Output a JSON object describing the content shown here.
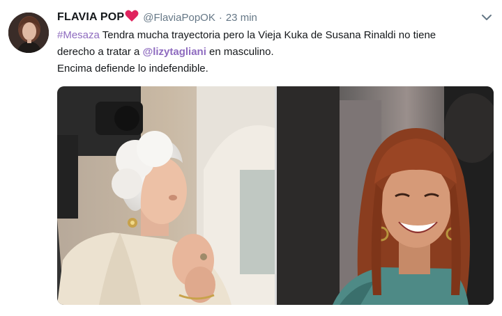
{
  "tweet": {
    "author_name": "FLAVIA POP",
    "handle": "@FlaviaPopOK",
    "separator": "·",
    "time": "23 min",
    "text": {
      "hashtag": "#Mesaza",
      "line1_rest": " Tendra mucha trayectoria pero la Vieja Kuka de Susana Rinaldi no tiene",
      "line2_start": "derecho a tratar a ",
      "mention": "@lizytagliani",
      "line2_end": " en masculino.",
      "line3": "Encima defiende lo indefendible."
    }
  },
  "icons": {
    "heart": "red-heart-emoji",
    "caret": "chevron-down-icon"
  },
  "colors": {
    "link": "#8e6bbf",
    "meta": "#657786",
    "heart": "#e0245e"
  }
}
